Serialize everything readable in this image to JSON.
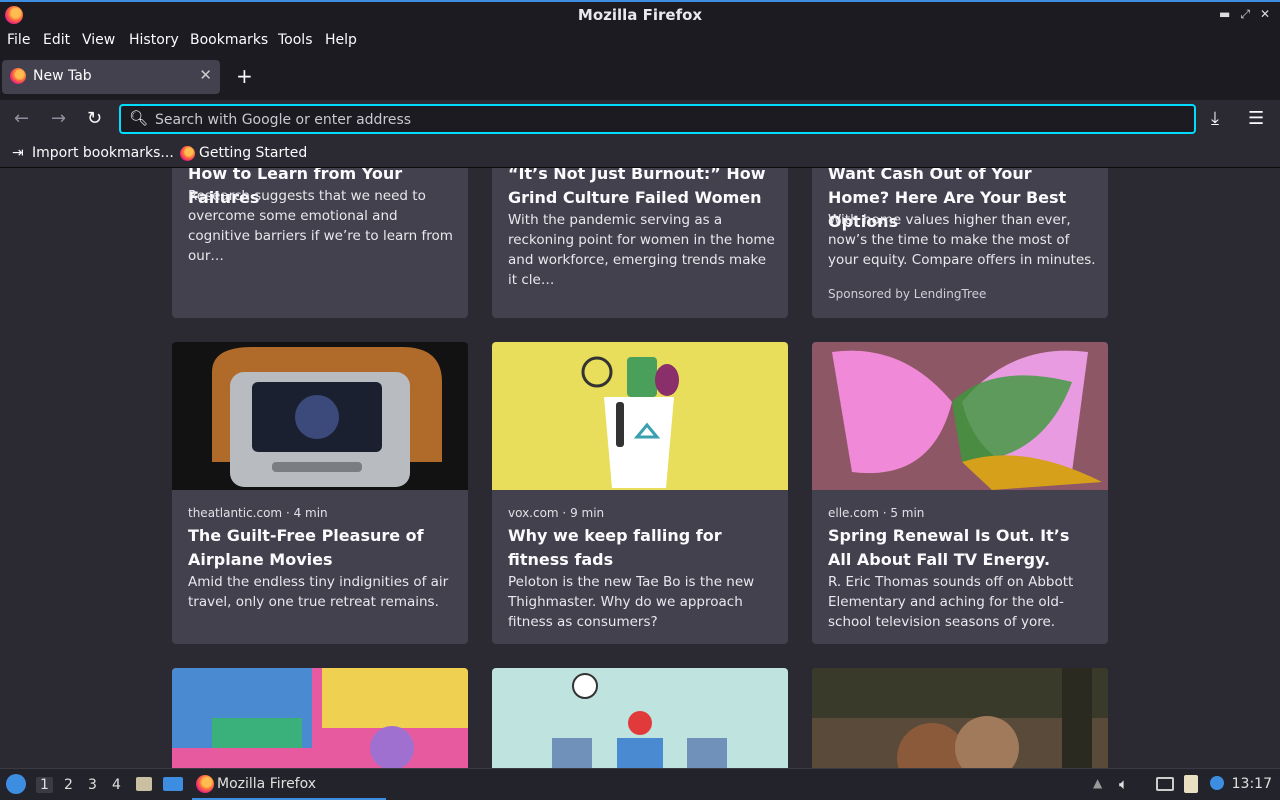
{
  "window": {
    "title": "Mozilla Firefox"
  },
  "menu": [
    "File",
    "Edit",
    "View",
    "History",
    "Bookmarks",
    "Tools",
    "Help"
  ],
  "tab": {
    "label": "New Tab"
  },
  "search": {
    "placeholder": "Search with Google or enter address"
  },
  "bookmarks": {
    "import_label": "Import bookmarks...",
    "getting_started_label": "Getting Started"
  },
  "cards_row1": [
    {
      "headline": "How to Learn from Your Failures",
      "excerpt": "Research suggests that we need to overcome some emotional and cognitive barriers if we’re to learn from our…"
    },
    {
      "headline": "“It’s Not Just Burnout:” How Grind Culture Failed Women",
      "excerpt": "With the pandemic serving as a reckoning point for women in the home and workforce, emerging trends make it cle…"
    },
    {
      "headline": "Want Cash Out of Your Home? Here Are Your Best Options",
      "excerpt": "With home values higher than ever, now’s the time to make the most of your equity. Compare offers in minutes.",
      "sponsor": "Sponsored by LendingTree"
    }
  ],
  "cards_row2": [
    {
      "source": "theatlantic.com · 4 min",
      "headline": "The Guilt-Free Pleasure of Airplane Movies",
      "excerpt": "Amid the endless tiny indignities of air travel, only one true retreat remains."
    },
    {
      "source": "vox.com · 9 min",
      "headline": "Why we keep falling for fitness fads",
      "excerpt": "Peloton is the new Tae Bo is the new Thighmaster. Why do we approach fitness as consumers?"
    },
    {
      "source": "elle.com · 5 min",
      "headline": "Spring Renewal Is Out. It’s All About Fall TV Energy.",
      "excerpt": "R. Eric Thomas sounds off on Abbott Elementary and aching for the old-school television seasons of yore."
    }
  ],
  "taskbar": {
    "workspaces": [
      "1",
      "2",
      "3",
      "4"
    ],
    "app_label": "Mozilla Firefox",
    "clock": "13:17"
  }
}
